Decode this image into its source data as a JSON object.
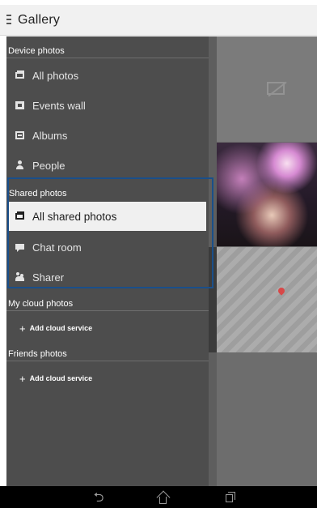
{
  "app": {
    "title": "Gallery"
  },
  "drawer": {
    "device_photos": {
      "header": "Device photos",
      "items": [
        {
          "label": "All photos",
          "icon": "photos-icon"
        },
        {
          "label": "Events wall",
          "icon": "events-wall-icon"
        },
        {
          "label": "Albums",
          "icon": "albums-icon"
        },
        {
          "label": "People",
          "icon": "people-icon"
        }
      ]
    },
    "shared_photos": {
      "header": "Shared photos",
      "items": [
        {
          "label": "All shared photos",
          "icon": "shared-photos-icon",
          "selected": true
        },
        {
          "label": "Chat room",
          "icon": "chat-room-icon"
        },
        {
          "label": "Sharer",
          "icon": "sharer-icon"
        }
      ]
    },
    "my_cloud_photos": {
      "header": "My cloud photos",
      "add_label": "Add cloud service"
    },
    "friends_photos": {
      "header": "Friends photos",
      "add_label": "Add cloud service"
    }
  },
  "system_bar": {
    "back_icon": "back-icon",
    "home_icon": "home-icon",
    "recents_icon": "recent-apps-icon"
  },
  "colors": {
    "drawer_bg": "#4d4d4d",
    "selected_bg": "#f0f0f0",
    "highlight_border": "#1a4f8a",
    "appbar_bg": "#f1f1f1"
  }
}
